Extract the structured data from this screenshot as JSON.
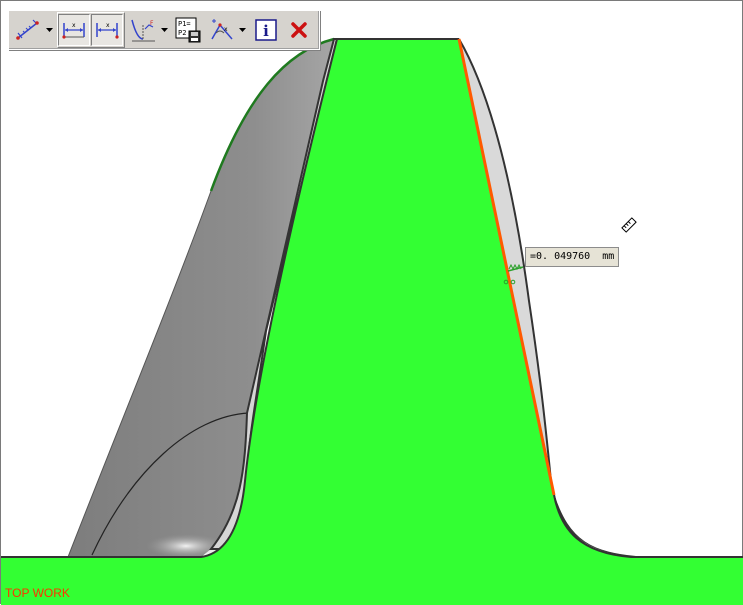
{
  "toolbar": {
    "buttons": [
      {
        "id": "point-distance",
        "icon": "point-to-point-measure-icon",
        "has_dropdown": true
      },
      {
        "id": "horizontal-distance",
        "icon": "horizontal-distance-icon",
        "pressed": true
      },
      {
        "id": "horizontal-distance-2",
        "icon": "horizontal-distance-alt-icon",
        "pressed": true
      },
      {
        "id": "deviation",
        "icon": "deviation-curve-icon",
        "has_dropdown": true
      },
      {
        "id": "points-save",
        "icon": "p1-p2-save-icon",
        "text_top": "P1=",
        "text_bottom": "P2"
      },
      {
        "id": "angle-measure",
        "icon": "angle-measure-icon",
        "has_dropdown": true
      },
      {
        "id": "info",
        "icon": "info-icon",
        "text": "i"
      },
      {
        "id": "close",
        "icon": "close-icon"
      }
    ]
  },
  "measurement": {
    "value_text": "=0. 049760  mm"
  },
  "view": {
    "label": "TOP WORK"
  },
  "colors": {
    "part_green": "#33ff33",
    "gray_surface": "#8a8a8a",
    "light_surface": "#d9d9d9",
    "measure_line": "#ff5a00",
    "outline": "#333333",
    "view_label": "#ff3300"
  }
}
